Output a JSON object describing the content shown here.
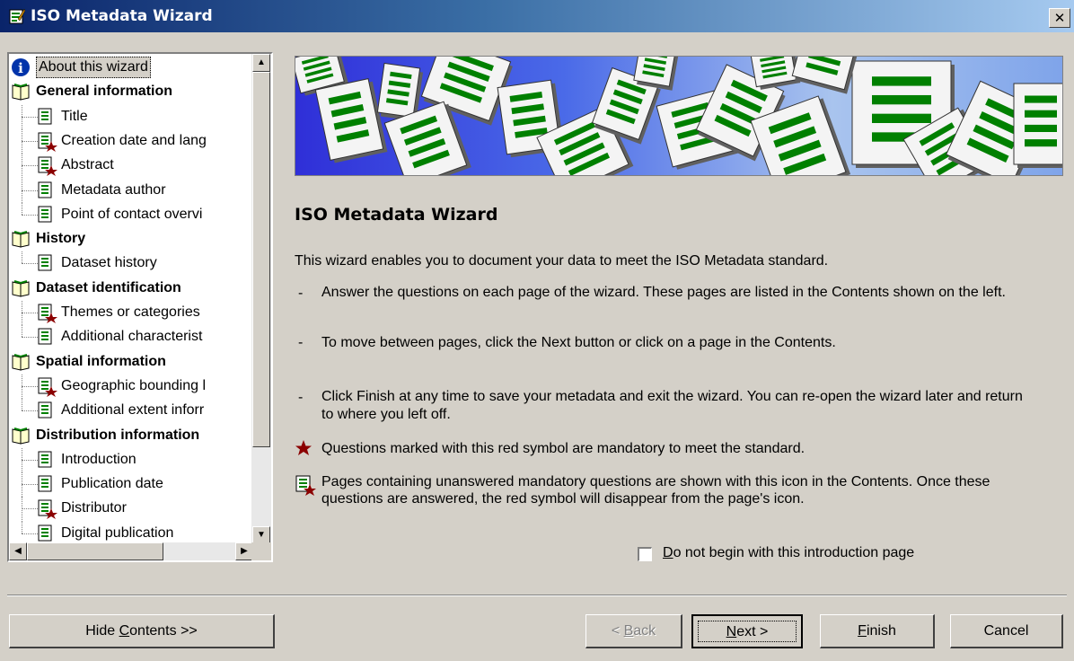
{
  "window": {
    "title": "ISO Metadata Wizard",
    "close_glyph": "✕"
  },
  "toc": {
    "items": [
      {
        "label": "About this wizard",
        "type": "info",
        "level": 0
      },
      {
        "label": "General information",
        "type": "group",
        "level": 0
      },
      {
        "label": "Title",
        "type": "page",
        "level": 1
      },
      {
        "label": "Creation date and lang",
        "type": "page-mandatory",
        "level": 1
      },
      {
        "label": "Abstract",
        "type": "page-mandatory",
        "level": 1
      },
      {
        "label": "Metadata author",
        "type": "page",
        "level": 1
      },
      {
        "label": "Point of contact overvi",
        "type": "page",
        "level": 1
      },
      {
        "label": "History",
        "type": "group",
        "level": 0
      },
      {
        "label": "Dataset history",
        "type": "page",
        "level": 1
      },
      {
        "label": "Dataset identification",
        "type": "group",
        "level": 0
      },
      {
        "label": "Themes or categories",
        "type": "page-mandatory",
        "level": 1
      },
      {
        "label": "Additional characterist",
        "type": "page",
        "level": 1
      },
      {
        "label": "Spatial information",
        "type": "group",
        "level": 0
      },
      {
        "label": "Geographic bounding l",
        "type": "page-mandatory",
        "level": 1
      },
      {
        "label": "Additional extent inforr",
        "type": "page",
        "level": 1
      },
      {
        "label": "Distribution information",
        "type": "group",
        "level": 0
      },
      {
        "label": "Introduction",
        "type": "page",
        "level": 1
      },
      {
        "label": "Publication date",
        "type": "page",
        "level": 1
      },
      {
        "label": "Distributor",
        "type": "page-mandatory",
        "level": 1
      },
      {
        "label": "Digital publication",
        "type": "page",
        "level": 1
      }
    ],
    "selected_index": 0
  },
  "main": {
    "heading": "ISO Metadata Wizard",
    "intro": "This wizard enables you to document your data to meet the ISO Metadata standard.",
    "bullet_dash": "-",
    "bullets": [
      "Answer the questions on each page of the wizard.  These pages are listed in the Contents shown on the left.",
      "To move between pages, click the Next button or click on a page in the Contents.",
      "Click Finish at any time to save your metadata and exit the wizard.  You can re-open the wizard later and return to where you left off."
    ],
    "mandatory_note": "Questions marked with this red symbol are mandatory to meet the standard.",
    "icon_note": "Pages containing unanswered mandatory questions are shown with this icon in the Contents. Once these questions are answered, the red symbol will disappear from the page's icon.",
    "checkbox": {
      "pre": "",
      "accel": "D",
      "post": "o not begin with this introduction page",
      "checked": false
    }
  },
  "buttons": {
    "hide_contents": {
      "pre": "Hide ",
      "accel": "C",
      "post": "ontents >>"
    },
    "back": {
      "pre": "< ",
      "accel": "B",
      "post": "ack",
      "enabled": false
    },
    "next": {
      "pre": "",
      "accel": "N",
      "post": "ext >"
    },
    "finish": {
      "pre": "",
      "accel": "F",
      "post": "inish"
    },
    "cancel": {
      "label": "Cancel"
    }
  },
  "colors": {
    "mandatory_star": "#8b0000",
    "doc_green": "#008000",
    "title_bar": "#0a246a"
  }
}
